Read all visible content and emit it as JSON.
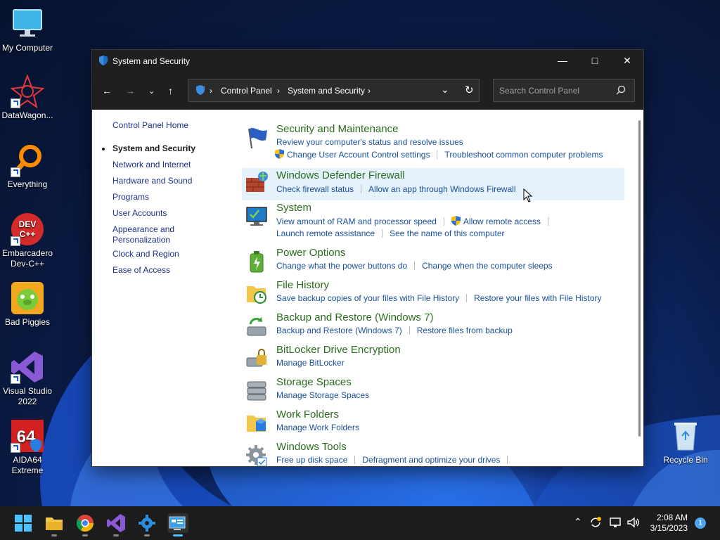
{
  "desktop": {
    "icons": [
      {
        "label": "My Computer"
      },
      {
        "label": "DataWagon..."
      },
      {
        "label": "Everything"
      },
      {
        "label": "Embarcadero Dev-C++"
      },
      {
        "label": "Bad Piggies"
      },
      {
        "label": "Visual Studio 2022"
      },
      {
        "label": "AIDA64 Extreme"
      },
      {
        "label": "Recycle Bin"
      }
    ]
  },
  "window": {
    "title": "System and Security",
    "address": {
      "root": "Control Panel",
      "current": "System and Security"
    },
    "search_placeholder": "Search Control Panel"
  },
  "sidebar": {
    "items": [
      {
        "label": "Control Panel Home"
      },
      {
        "label": "System and Security"
      },
      {
        "label": "Network and Internet"
      },
      {
        "label": "Hardware and Sound"
      },
      {
        "label": "Programs"
      },
      {
        "label": "User Accounts"
      },
      {
        "label": "Appearance and Personalization"
      },
      {
        "label": "Clock and Region"
      },
      {
        "label": "Ease of Access"
      }
    ]
  },
  "categories": [
    {
      "title": "Security and Maintenance",
      "links": [
        "Review your computer's status and resolve issues",
        "Change User Account Control settings",
        "Troubleshoot common computer problems"
      ]
    },
    {
      "title": "Windows Defender Firewall",
      "links": [
        "Check firewall status",
        "Allow an app through Windows Firewall"
      ]
    },
    {
      "title": "System",
      "links": [
        "View amount of RAM and processor speed",
        "Allow remote access",
        "Launch remote assistance",
        "See the name of this computer"
      ]
    },
    {
      "title": "Power Options",
      "links": [
        "Change what the power buttons do",
        "Change when the computer sleeps"
      ]
    },
    {
      "title": "File History",
      "links": [
        "Save backup copies of your files with File History",
        "Restore your files with File History"
      ]
    },
    {
      "title": "Backup and Restore (Windows 7)",
      "links": [
        "Backup and Restore (Windows 7)",
        "Restore files from backup"
      ]
    },
    {
      "title": "BitLocker Drive Encryption",
      "links": [
        "Manage BitLocker"
      ]
    },
    {
      "title": "Storage Spaces",
      "links": [
        "Manage Storage Spaces"
      ]
    },
    {
      "title": "Work Folders",
      "links": [
        "Manage Work Folders"
      ]
    },
    {
      "title": "Windows Tools",
      "links": [
        "Free up disk space",
        "Defragment and optimize your drives"
      ]
    }
  ],
  "taskbar": {
    "time": "2:08 AM",
    "date": "3/15/2023",
    "notification_count": "1"
  },
  "colors": {
    "link": "#1a4f9c",
    "category_title": "#2a6d1e",
    "hover_row": "#e5f1fb",
    "titlebar": "#1f1f1f",
    "taskbar": "#1c1c1c"
  }
}
